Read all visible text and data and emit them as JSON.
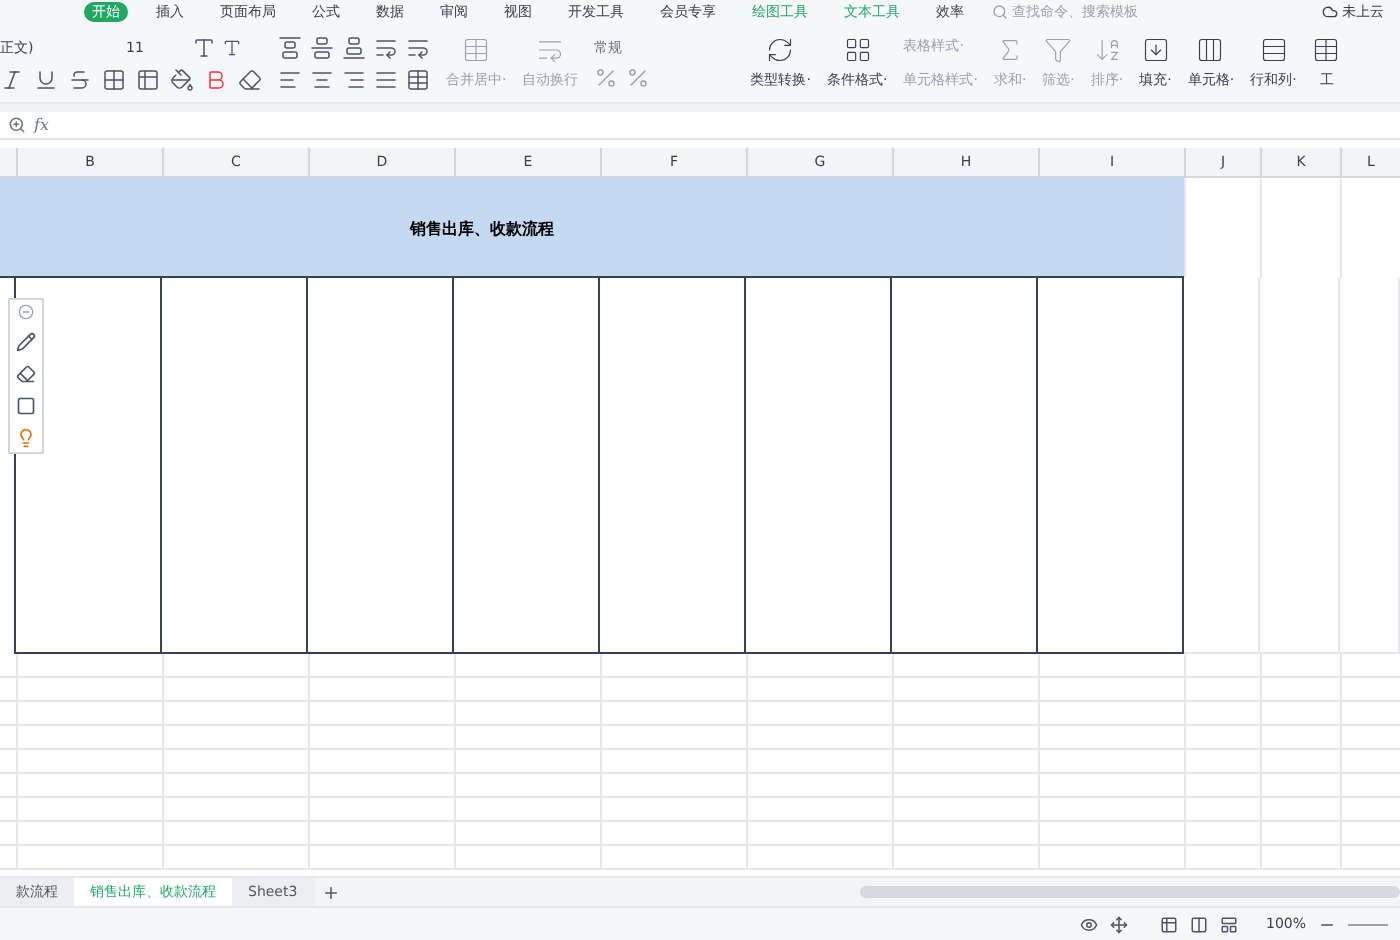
{
  "menu_tabs": [
    {
      "label": "开始",
      "selected": true,
      "kind": "main"
    },
    {
      "label": "插入",
      "selected": false,
      "kind": "main"
    },
    {
      "label": "页面布局",
      "selected": false,
      "kind": "main"
    },
    {
      "label": "公式",
      "selected": false,
      "kind": "main"
    },
    {
      "label": "数据",
      "selected": false,
      "kind": "main"
    },
    {
      "label": "审阅",
      "selected": false,
      "kind": "main"
    },
    {
      "label": "视图",
      "selected": false,
      "kind": "main"
    },
    {
      "label": "开发工具",
      "selected": false,
      "kind": "main"
    },
    {
      "label": "会员专享",
      "selected": false,
      "kind": "main"
    },
    {
      "label": "绘图工具",
      "selected": false,
      "kind": "context"
    },
    {
      "label": "文本工具",
      "selected": false,
      "kind": "context"
    },
    {
      "label": "效率",
      "selected": false,
      "kind": "main"
    }
  ],
  "search": {
    "placeholder": "查找命令、搜索模板"
  },
  "cloud": "未上云",
  "font": {
    "name": "正文)",
    "size": "11"
  },
  "ribbon_labels": [
    {
      "label": "合并居中·",
      "disabled": true
    },
    {
      "label": "自动换行",
      "disabled": true
    }
  ],
  "number_format": "常规",
  "formula_label": "fx",
  "ribbon_buttons": [
    {
      "label": "类型转换·",
      "disabled": false
    },
    {
      "label": "条件格式·",
      "disabled": false
    }
  ],
  "style_buttons": [
    {
      "label": "表格样式·",
      "disabled": true
    },
    {
      "label": "单元格样式·",
      "disabled": true
    }
  ],
  "tool_buttons": [
    {
      "label": "求和·",
      "disabled": true
    },
    {
      "label": "筛选·",
      "disabled": true
    },
    {
      "label": "排序·",
      "disabled": true
    },
    {
      "label": "填充·",
      "disabled": false
    },
    {
      "label": "单元格·",
      "disabled": false
    },
    {
      "label": "行和列·",
      "disabled": false
    },
    {
      "label": "工",
      "disabled": false
    }
  ],
  "columns": [
    "B",
    "C",
    "D",
    "E",
    "F",
    "G",
    "H",
    "I",
    "J",
    "K",
    "L"
  ],
  "title_cell": "销售出库、收款流程",
  "sheet_tabs": [
    {
      "label": "款流程",
      "selected": false
    },
    {
      "label": "销售出库、收款流程",
      "selected": true
    },
    {
      "label": "Sheet3",
      "selected": false
    }
  ],
  "zoom": "100%"
}
